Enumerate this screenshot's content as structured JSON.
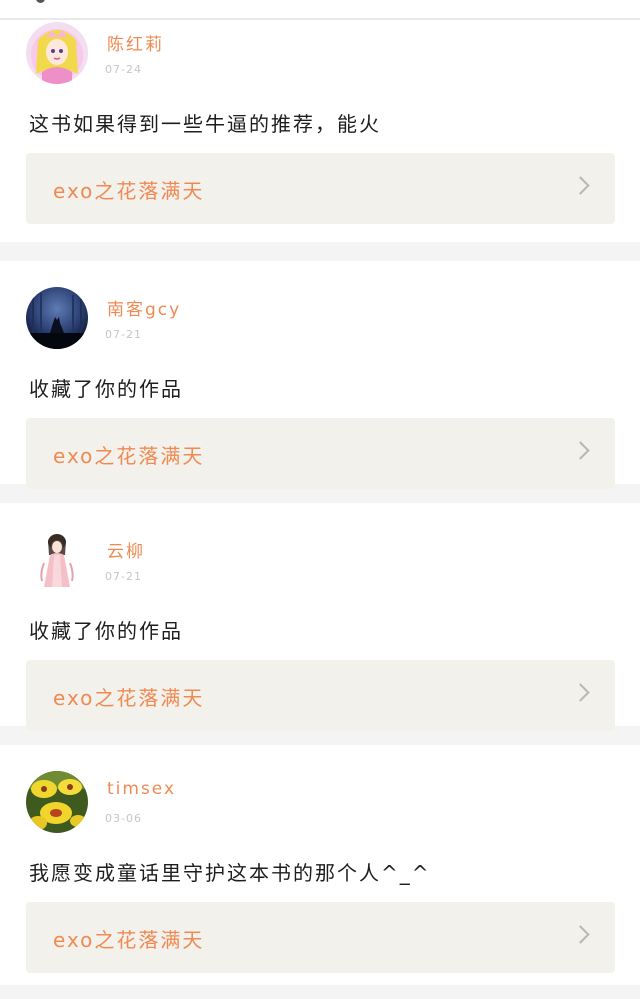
{
  "comments": [
    {
      "username": "陈红莉",
      "date": "07-24",
      "message": "这书如果得到一些牛逼的推荐，能火",
      "book_title": "exo之花落满天",
      "avatar_icon": "anime-princess-avatar"
    },
    {
      "username": "南客gcy",
      "date": "07-21",
      "message": "收藏了你的作品",
      "book_title": "exo之花落满天",
      "avatar_icon": "wolf-night-avatar"
    },
    {
      "username": "云柳",
      "date": "07-21",
      "message": "收藏了你的作品",
      "book_title": "exo之花落满天",
      "avatar_icon": "ancient-girl-avatar"
    },
    {
      "username": "timsex",
      "date": "03-06",
      "message": "我愿变成童话里守护这本书的那个人^_^",
      "book_title": "exo之花落满天",
      "avatar_icon": "yellow-flower-avatar"
    }
  ],
  "colors": {
    "accent": "#f08a52",
    "text": "#1e1e1e",
    "muted": "#c6c6c6",
    "panel": "#f2f1ec",
    "separator": "#f4f4f4"
  }
}
